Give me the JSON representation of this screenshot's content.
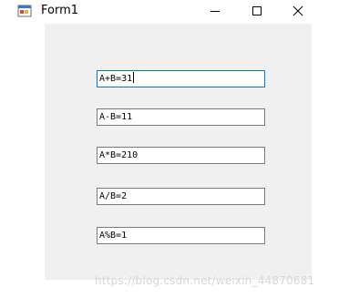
{
  "window": {
    "title": "Form1"
  },
  "icons": {
    "app": "winforms-app-icon",
    "minimize": "minimize-icon",
    "maximize": "maximize-icon",
    "close": "close-icon"
  },
  "colors": {
    "client_background": "#f0f0f0",
    "focus_border": "#0078d7",
    "textbox_border": "#7a7a7a"
  },
  "fields": [
    {
      "name": "sum",
      "value": "A+B=31",
      "focused": true
    },
    {
      "name": "difference",
      "value": "A-B=11",
      "focused": false
    },
    {
      "name": "product",
      "value": "A*B=210",
      "focused": false
    },
    {
      "name": "quotient",
      "value": "A/B=2",
      "focused": false
    },
    {
      "name": "modulo",
      "value": "A%B=1",
      "focused": false
    }
  ],
  "watermark": "https://blog.csdn.net/weixin_44870681"
}
